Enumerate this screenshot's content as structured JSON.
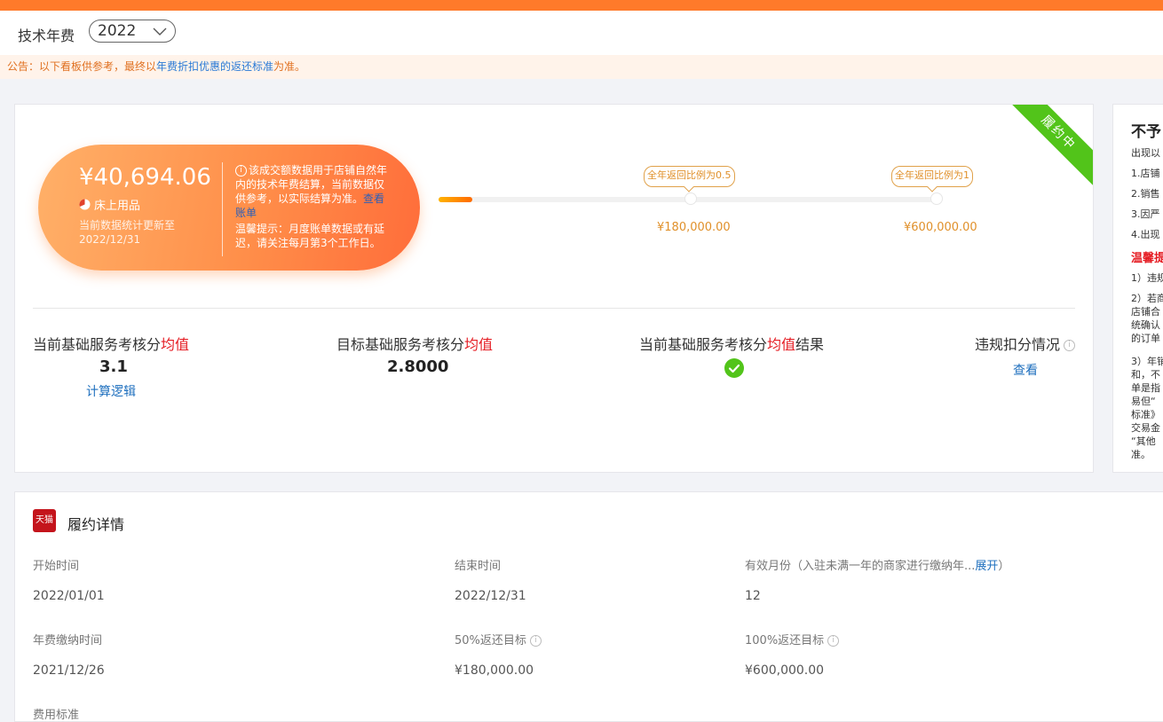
{
  "header": {
    "label": "技术年费",
    "year": "2022"
  },
  "notice": {
    "prefix": "公告：以下看板供参考，最终以",
    "highlight": "年费折扣优惠的返还标准",
    "suffix": "为准。"
  },
  "status_ribbon": "履约中",
  "summary": {
    "amount": "¥40,694.06",
    "category": "床上用品",
    "update_line1": "当前数据统计更新至",
    "update_line2": "2022/12/31",
    "info_text": "该成交额数据用于店铺自然年内的技术年费结算，当前数据仅供参考，以实际结算为准。",
    "info_link": "查看账单",
    "tip_text": "温馨提示：月度账单数据或有延迟，请关注每月第3个工作日。"
  },
  "progress": {
    "fraction": 0.068,
    "milestones": [
      {
        "label": "全年返回比例为0.5",
        "amount": "¥180,000.00"
      },
      {
        "label": "全年返回比例为1",
        "amount": "¥600,000.00"
      }
    ]
  },
  "metrics": {
    "current": {
      "title_prefix": "当前基础服务考核分",
      "title_red": "均值",
      "value": "3.1",
      "link": "计算逻辑"
    },
    "target": {
      "title_prefix": "目标基础服务考核分",
      "title_red": "均值",
      "value": "2.8000"
    },
    "result": {
      "title_prefix": "当前基础服务考核分",
      "title_red": "均值",
      "title_suffix": "结果"
    },
    "violation": {
      "title": "违规扣分情况",
      "link": "查看"
    }
  },
  "side_panel": {
    "title": "不予",
    "intro": "出现以",
    "items": [
      "1.店铺",
      "2.销售",
      "3.因严",
      "4.出现"
    ],
    "warning": "温馨提",
    "para1": "1）违规",
    "para2": [
      "2）若商",
      "店铺合",
      "统确认",
      "的订单"
    ],
    "para3": [
      "3）年销",
      "和，不",
      "单是指",
      "易但“",
      "标准》",
      "交易金",
      "“其他",
      "准。"
    ]
  },
  "details": {
    "title": "履约详情",
    "logo_text": "天猫",
    "start_label": "开始时间",
    "start_value": "2022/01/01",
    "end_label": "结束时间",
    "end_value": "2022/12/31",
    "months_label": "有效月份（入驻未满一年的商家进行缴纳年...",
    "months_expand": "展开",
    "months_close": "）",
    "months_value": "12",
    "pay_label": "年费缴纳时间",
    "pay_value": "2021/12/26",
    "target50_label": "50%返还目标",
    "target50_value": "¥180,000.00",
    "target100_label": "100%返还目标",
    "target100_value": "¥600,000.00",
    "fee_label": "费用标准"
  },
  "colors": {
    "accent": "#ff7a2a",
    "link": "#1e6fbe",
    "success": "#52c41a",
    "highlight_red": "#e51c23"
  }
}
